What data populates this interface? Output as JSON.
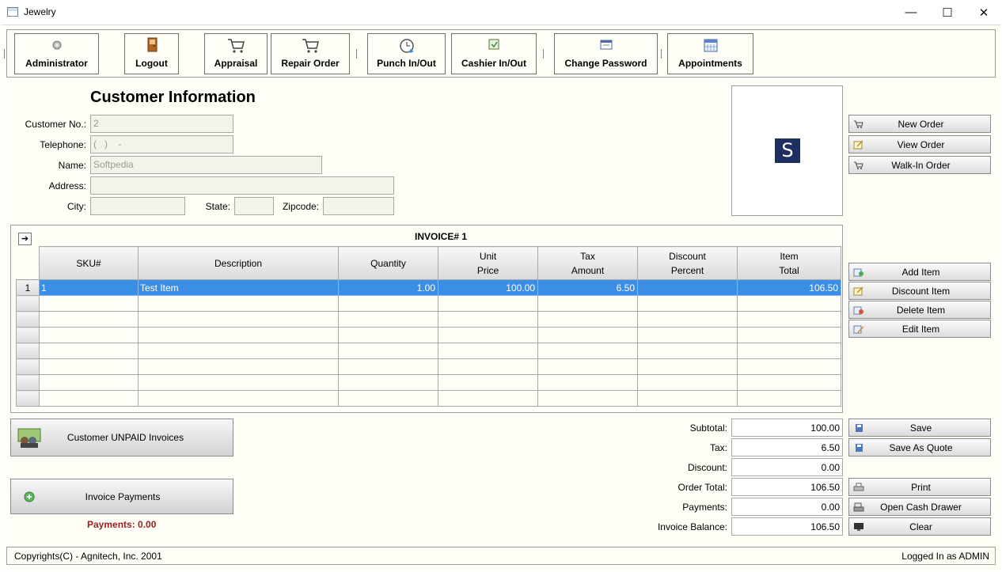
{
  "window": {
    "title": "Jewelry",
    "minimize": "—",
    "maximize": "☐",
    "close": "✕"
  },
  "toolbar": {
    "administrator": "Administrator",
    "logout": "Logout",
    "appraisal": "Appraisal",
    "repair_order": "Repair Order",
    "punch": "Punch In/Out",
    "cashier": "Cashier In/Out",
    "change_password": "Change Password",
    "appointments": "Appointments"
  },
  "customer": {
    "heading": "Customer Information",
    "customer_no_label": "Customer No.:",
    "customer_no": "2",
    "telephone_label": "Telephone:",
    "telephone": "(   )    -",
    "name_label": "Name:",
    "name": "Softpedia",
    "address_label": "Address:",
    "address": "",
    "city_label": "City:",
    "city": "",
    "state_label": "State:",
    "state": "",
    "zip_label": "Zipcode:",
    "zip": ""
  },
  "photo": {
    "logo_letter": "S"
  },
  "order_buttons": {
    "new_order": "New Order",
    "view_order": "View Order",
    "walk_in": "Walk-In Order"
  },
  "invoice": {
    "title": "INVOICE# 1",
    "arrow": "➔",
    "columns": {
      "sku": "SKU#",
      "description": "Description",
      "quantity": "Quantity",
      "unit_price_1": "Unit",
      "unit_price_2": "Price",
      "tax_1": "Tax",
      "tax_2": "Amount",
      "discount_1": "Discount",
      "discount_2": "Percent",
      "total_1": "Item",
      "total_2": "Total"
    },
    "rows": [
      {
        "row": "1",
        "sku": "1",
        "description": "Test Item",
        "quantity": "1.00",
        "unit_price": "100.00",
        "tax": "6.50",
        "discount": "",
        "total": "106.50"
      }
    ]
  },
  "item_buttons": {
    "add": "Add Item",
    "discount": "Discount Item",
    "delete": "Delete Item",
    "edit": "Edit Item"
  },
  "unpaid_button": "Customer UNPAID Invoices",
  "invoice_payments_button": "Invoice Payments",
  "payments_note": "Payments: 0.00",
  "totals": {
    "subtotal_label": "Subtotal:",
    "subtotal": "100.00",
    "tax_label": "Tax:",
    "tax": "6.50",
    "discount_label": "Discount:",
    "discount": "0.00",
    "order_total_label": "Order Total:",
    "order_total": "106.50",
    "payments_label": "Payments:",
    "payments": "0.00",
    "balance_label": "Invoice Balance:",
    "balance": "106.50"
  },
  "action_buttons": {
    "save": "Save",
    "save_quote": "Save As Quote",
    "print": "Print",
    "cash_drawer": "Open Cash Drawer",
    "clear": "Clear"
  },
  "status": {
    "copyright": "Copyrights(C) - Agnitech, Inc. 2001",
    "logged_in": "Logged In as ADMIN"
  },
  "colors": {
    "background": "#fffef6",
    "selection": "#3a8ee6",
    "payments_note": "#9c1d1d",
    "logo": "#1d2f61"
  }
}
